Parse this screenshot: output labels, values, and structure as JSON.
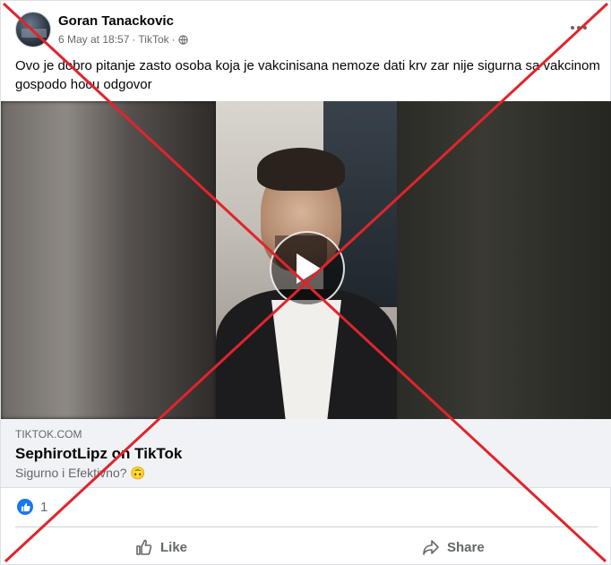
{
  "post": {
    "author": "Goran Tanackovic",
    "date": "6 May at 18:57",
    "source": "TikTok",
    "separator": "·",
    "text": "Ovo je dobro pitanje zasto osoba koja je vakcinisana nemoze dati krv zar nije sigurna sa vakcinom gospodo hocu odgovor"
  },
  "link": {
    "domain": "TIKTOK.COM",
    "title": "SephirotLipz on TikTok",
    "description": "Sigurno i Efektivno? 🙃"
  },
  "reactions": {
    "count": "1"
  },
  "actions": {
    "like_label": "Like",
    "share_label": "Share"
  },
  "icons": {
    "more": "more-options-icon",
    "privacy": "globe-icon",
    "play": "play-icon",
    "like_reaction": "like-reaction-icon",
    "like": "thumbs-up-icon",
    "share": "share-arrow-icon"
  },
  "colors": {
    "accent": "#1877f2",
    "x_overlay": "#e0242c",
    "secondary_text": "#65676b"
  }
}
